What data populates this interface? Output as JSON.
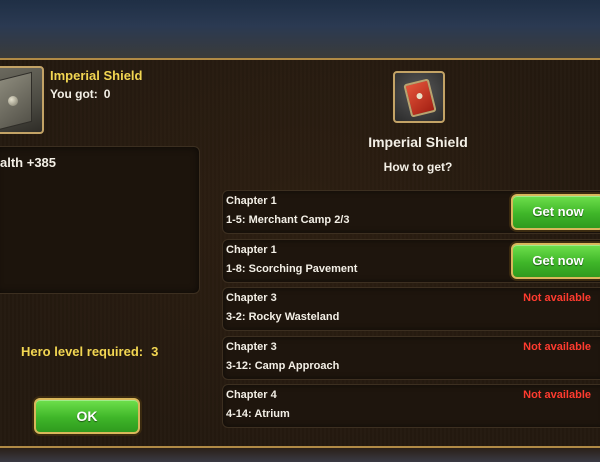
{
  "left": {
    "item_name": "Imperial Shield",
    "you_got_label": "You got:",
    "you_got_value": "0",
    "stat_text": "alth +385",
    "hero_level_label": "Hero level required:",
    "hero_level_value": "3",
    "ok_label": "OK"
  },
  "right": {
    "title": "Imperial Shield",
    "subtitle": "How to get?",
    "sources": [
      {
        "chapter": "Chapter 1",
        "stage": "1-5: Merchant Camp  2/3",
        "action": "Get now"
      },
      {
        "chapter": "Chapter 1",
        "stage": "1-8: Scorching Pavement",
        "action": "Get now"
      },
      {
        "chapter": "Chapter 3",
        "stage": "3-2: Rocky Wasteland",
        "status": "Not available"
      },
      {
        "chapter": "Chapter 3",
        "stage": "3-12: Camp Approach",
        "status": "Not available"
      },
      {
        "chapter": "Chapter 4",
        "stage": "4-14: Atrium",
        "status": "Not available"
      }
    ]
  },
  "icons": {
    "left_item": "gray-shield-icon",
    "right_item": "red-shield-icon"
  },
  "colors": {
    "gold_text": "#f2d652",
    "button_green": "#3fb629",
    "not_available_red": "#ff3b2f",
    "frame_gold": "#c3a366"
  }
}
